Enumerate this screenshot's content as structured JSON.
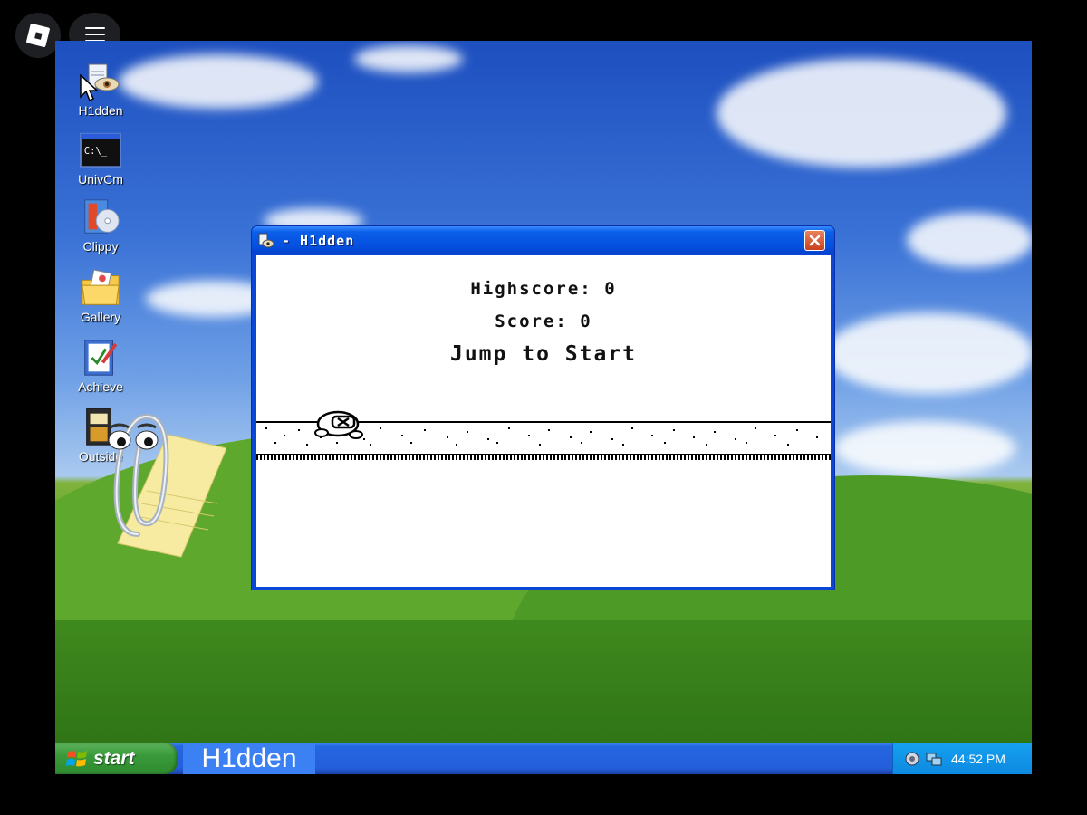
{
  "overlay": {
    "logo_icon": "roblox-logo-icon",
    "menu_icon": "hamburger-menu-icon"
  },
  "desktop_icons": [
    {
      "label": "H1dden",
      "icon": "eye-file-icon"
    },
    {
      "label": "UnivCm",
      "icon": "command-prompt-icon"
    },
    {
      "label": "Clippy",
      "icon": "software-box-icon"
    },
    {
      "label": "Gallery",
      "icon": "picture-folder-icon"
    },
    {
      "label": "Achieve",
      "icon": "notebook-pen-icon"
    },
    {
      "label": "Outside",
      "icon": "notepad-icon"
    }
  ],
  "window": {
    "title": "- H1dden",
    "game": {
      "highscore": "Highscore: 0",
      "score": "Score: 0",
      "prompt": "Jump to Start"
    }
  },
  "taskbar": {
    "start_label": "start",
    "task_item": "H1dden",
    "clock": "44:52 PM"
  },
  "colors": {
    "taskbar_blue": "#245edb",
    "start_green": "#3a9a3a",
    "title_blue": "#0550e0",
    "close_red": "#c9401e"
  }
}
